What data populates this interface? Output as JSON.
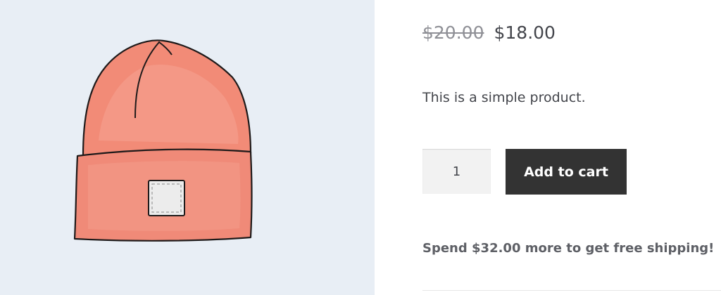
{
  "product": {
    "image_alt": "beanie-illustration",
    "regular_price": "$20.00",
    "sale_price": "$18.00",
    "short_description": "This is a simple product.",
    "quantity": "1",
    "add_to_cart_label": "Add to cart",
    "shipping_notice": "Spend $32.00 more to get free shipping!"
  },
  "colors": {
    "image_background": "#e8eef5",
    "beanie": "#f08a78",
    "button_background": "#333333",
    "old_price": "#8f9096"
  }
}
